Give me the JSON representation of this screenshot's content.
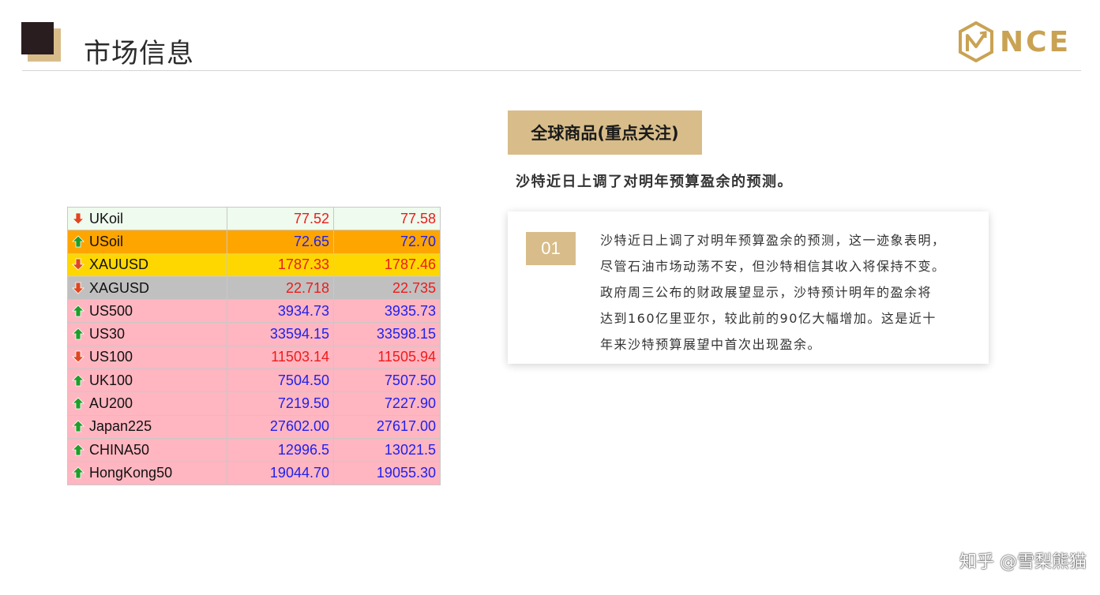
{
  "header": {
    "title": "市场信息",
    "logo_text": "NCE"
  },
  "colors": {
    "gold": "#d8bd8a",
    "dark_square": "#2a1d1f",
    "price_down": "#ee1b1b",
    "price_up": "#2020ee",
    "arrow_up": "#1f9e2a",
    "arrow_down": "#e0461f"
  },
  "market": {
    "rows": [
      {
        "symbol": "UKoil",
        "direction": "down",
        "bid": "77.52",
        "ask": "77.58",
        "bg": "#eefbee",
        "price_color": "#ee1b1b"
      },
      {
        "symbol": "USoil",
        "direction": "up",
        "bid": "72.65",
        "ask": "72.70",
        "bg": "#ffa500",
        "price_color": "#2020ee"
      },
      {
        "symbol": "XAUUSD",
        "direction": "down",
        "bid": "1787.33",
        "ask": "1787.46",
        "bg": "#ffd700",
        "price_color": "#ee1b1b"
      },
      {
        "symbol": "XAGUSD",
        "direction": "down",
        "bid": "22.718",
        "ask": "22.735",
        "bg": "#c0c0c0",
        "price_color": "#ee1b1b"
      },
      {
        "symbol": "US500",
        "direction": "up",
        "bid": "3934.73",
        "ask": "3935.73",
        "bg": "#ffb6c1",
        "price_color": "#2020ee"
      },
      {
        "symbol": "US30",
        "direction": "up",
        "bid": "33594.15",
        "ask": "33598.15",
        "bg": "#ffb6c1",
        "price_color": "#2020ee"
      },
      {
        "symbol": "US100",
        "direction": "down",
        "bid": "11503.14",
        "ask": "11505.94",
        "bg": "#ffb6c1",
        "price_color": "#ee1b1b"
      },
      {
        "symbol": "UK100",
        "direction": "up",
        "bid": "7504.50",
        "ask": "7507.50",
        "bg": "#ffb6c1",
        "price_color": "#2020ee"
      },
      {
        "symbol": "AU200",
        "direction": "up",
        "bid": "7219.50",
        "ask": "7227.90",
        "bg": "#ffb6c1",
        "price_color": "#2020ee"
      },
      {
        "symbol": "Japan225",
        "direction": "up",
        "bid": "27602.00",
        "ask": "27617.00",
        "bg": "#ffb6c1",
        "price_color": "#2020ee"
      },
      {
        "symbol": "CHINA50",
        "direction": "up",
        "bid": "12996.5",
        "ask": "13021.5",
        "bg": "#ffb6c1",
        "price_color": "#2020ee"
      },
      {
        "symbol": "HongKong50",
        "direction": "up",
        "bid": "19044.70",
        "ask": "19055.30",
        "bg": "#ffb6c1",
        "price_color": "#2020ee"
      }
    ]
  },
  "section": {
    "tag": "全球商品(重点关注)",
    "headline": "沙特近日上调了对明年预算盈余的预测。",
    "card": {
      "number": "01",
      "lines": [
        "沙特近日上调了对明年预算盈余的预测，这一迹象表明，",
        "尽管石油市场动荡不安，但沙特相信其收入将保持不变。",
        "政府周三公布的财政展望显示，沙特预计明年的盈余将",
        "达到160亿里亚尔，较此前的90亿大幅增加。这是近十",
        "年来沙特预算展望中首次出现盈余。"
      ]
    }
  },
  "watermark": "知乎 @雪梨熊猫"
}
